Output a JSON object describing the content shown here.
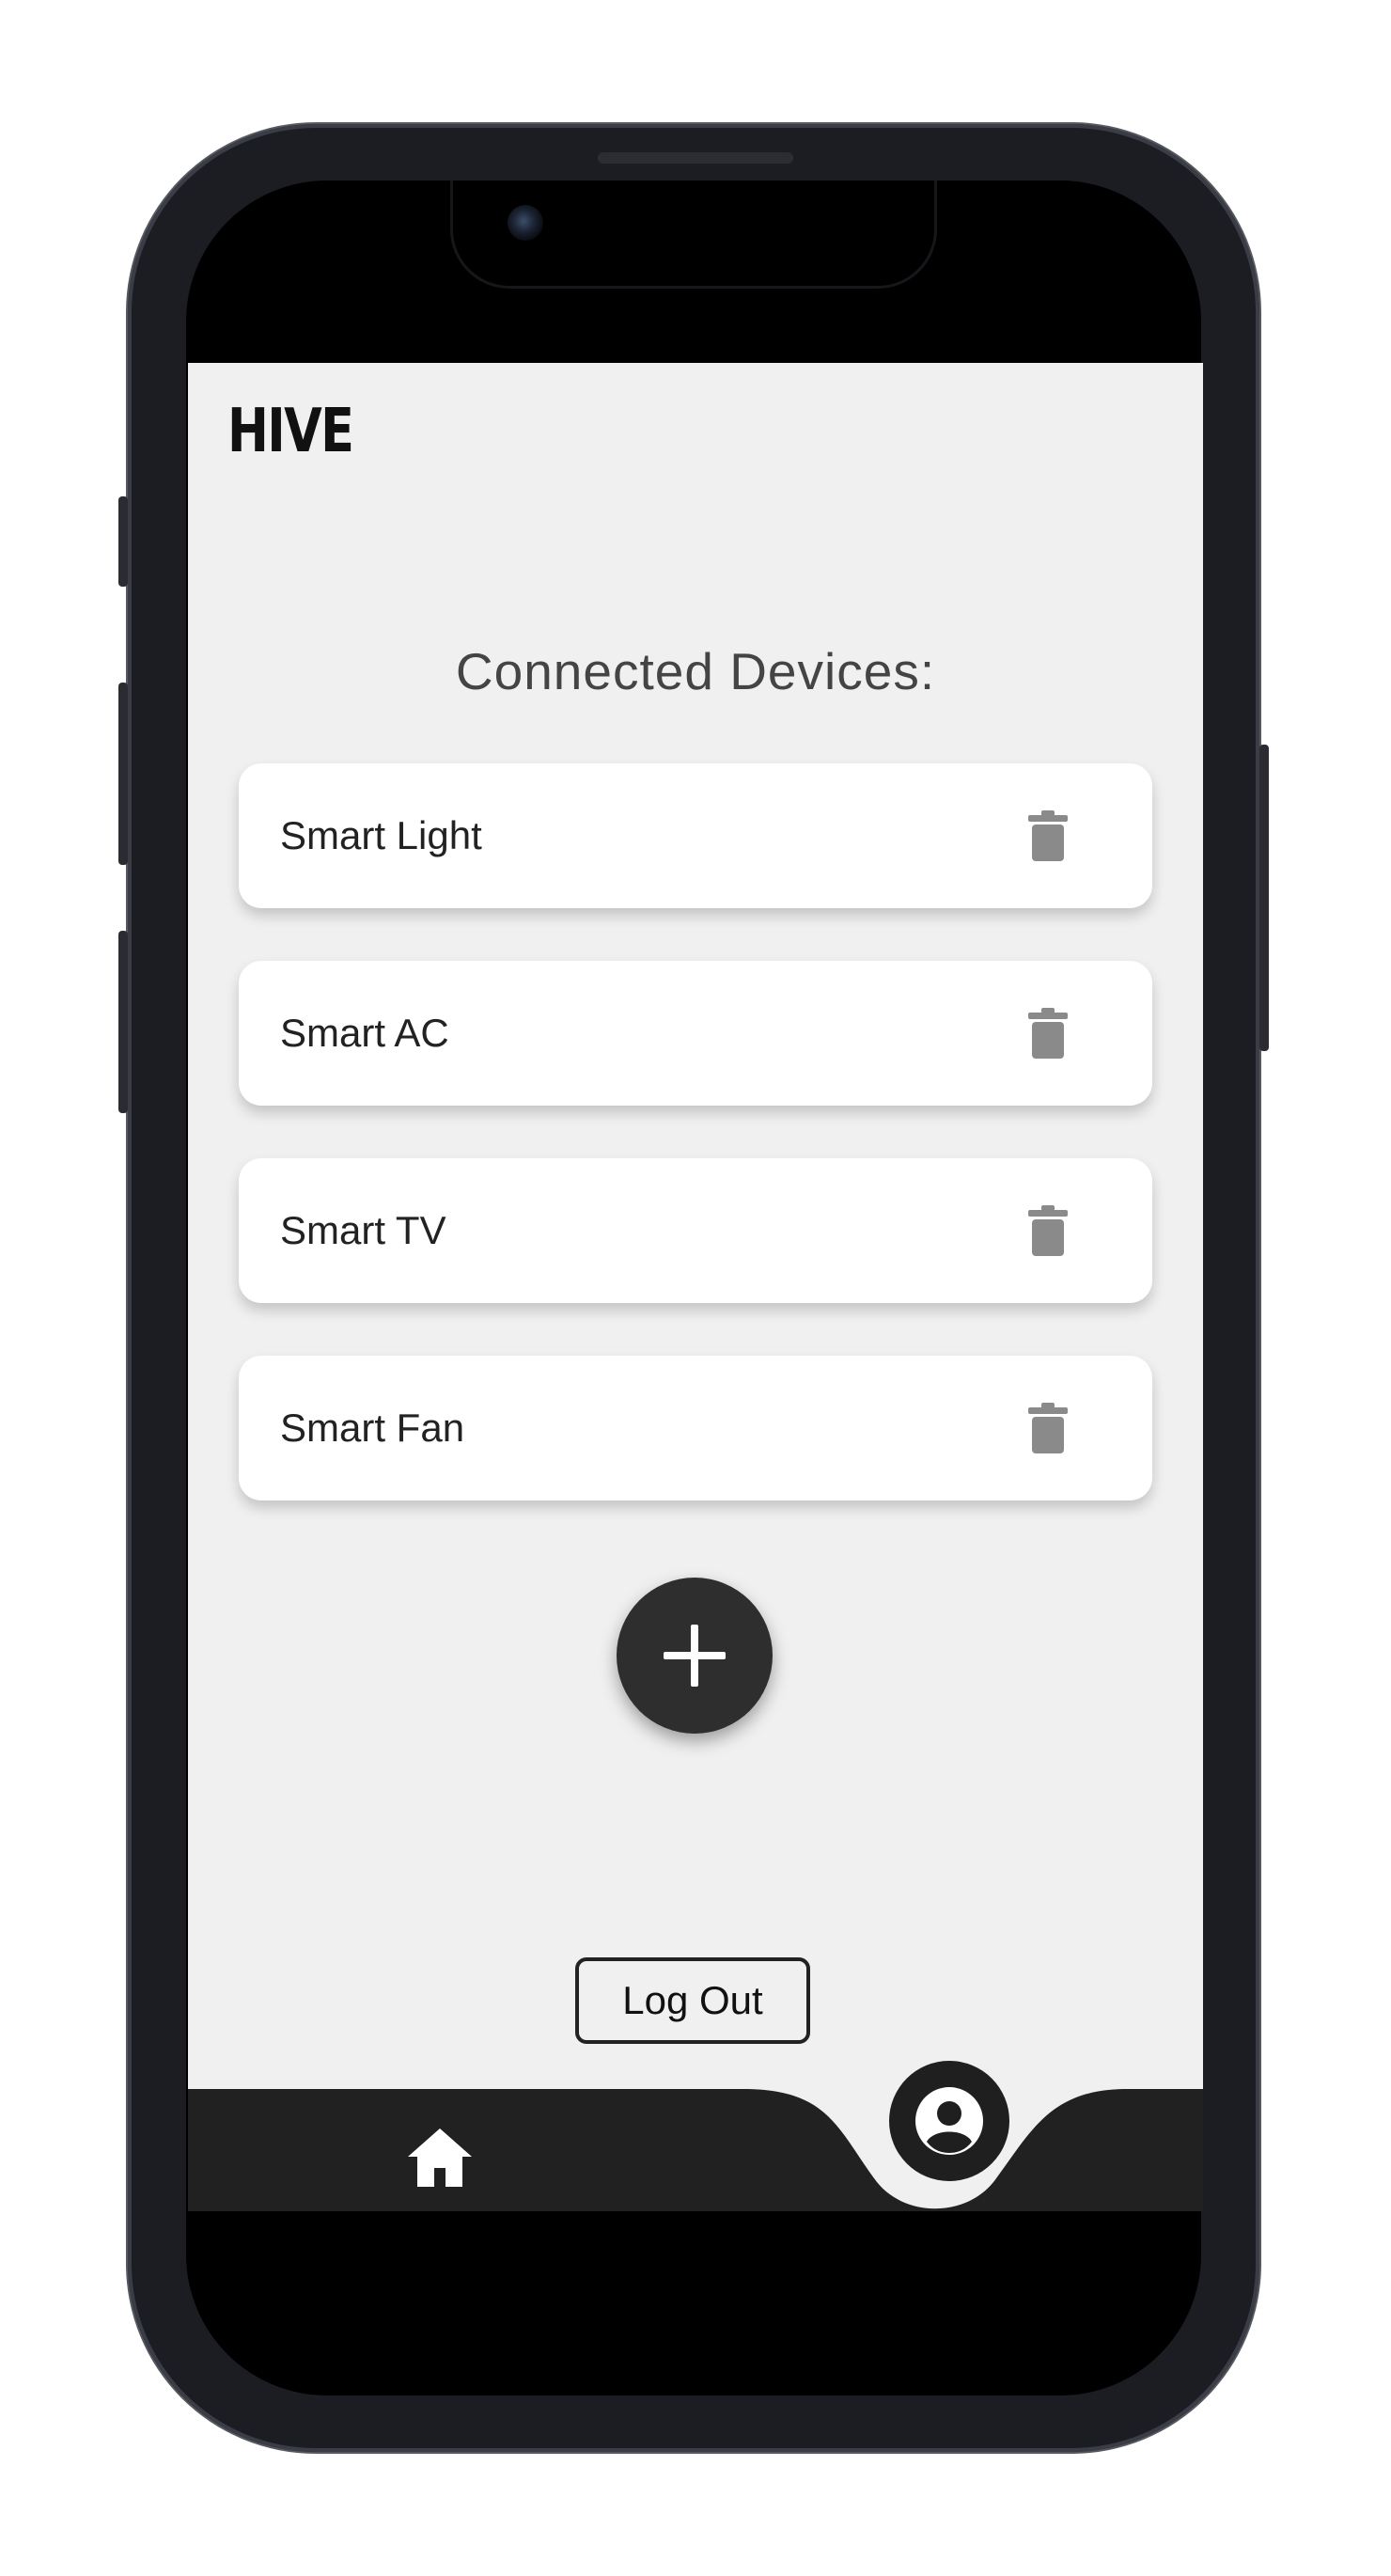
{
  "app": {
    "logo": "HIVE"
  },
  "main": {
    "heading": "Connected Devices:",
    "devices": [
      {
        "label": "Smart Light"
      },
      {
        "label": "Smart AC"
      },
      {
        "label": "Smart TV"
      },
      {
        "label": "Smart Fan"
      }
    ],
    "delete_icon": "trash-icon",
    "add_icon": "plus-icon"
  },
  "footer": {
    "logout_label": "Log Out",
    "nav": [
      {
        "icon": "home-icon"
      },
      {
        "icon": "account-circle-icon"
      }
    ]
  },
  "colors": {
    "background": "#f0f0f0",
    "card": "#ffffff",
    "navbar": "#212121",
    "fab": "#2e2e2e",
    "trash": "#8a8a8a"
  }
}
